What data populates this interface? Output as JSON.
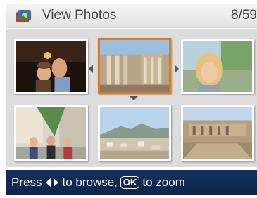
{
  "header": {
    "title": "View Photos",
    "counter": "8/59",
    "icon": "photos-icon"
  },
  "grid": {
    "thumbnails": [
      {
        "name": "couple-night",
        "selected": false
      },
      {
        "name": "ruins-columns",
        "selected": true
      },
      {
        "name": "woman-portrait",
        "selected": false
      },
      {
        "name": "group-street",
        "selected": false
      },
      {
        "name": "city-panorama",
        "selected": false
      },
      {
        "name": "theater-ruins",
        "selected": false
      }
    ],
    "icons": [
      "arrow-left-icon",
      "arrow-right-icon",
      "arrow-down-icon"
    ]
  },
  "footer": {
    "press": "Press",
    "browse": "to browse,",
    "ok": "OK",
    "zoom": "to zoom"
  },
  "colors": {
    "selection": "#e07a1f",
    "footer_bg": "#13325e"
  }
}
